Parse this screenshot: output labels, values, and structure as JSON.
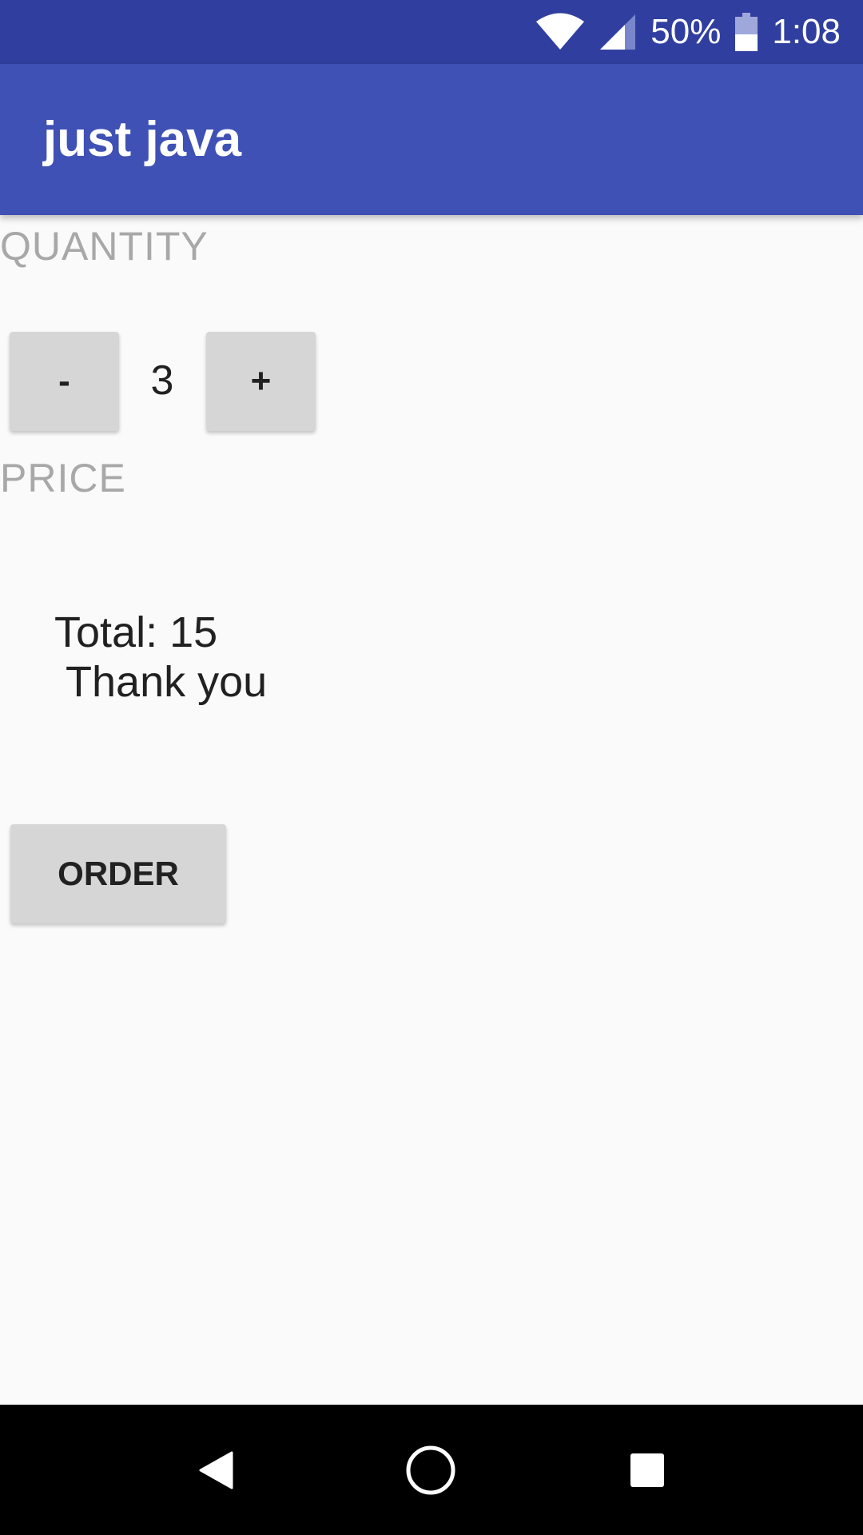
{
  "status_bar": {
    "wifi_icon": "wifi-icon",
    "cell_icon": "cell-signal-icon",
    "battery_text": "50%",
    "battery_level": 0.5,
    "time": "1:08",
    "background_color": "#303f9f"
  },
  "app_bar": {
    "title": "just java",
    "background_color": "#3f51b5"
  },
  "quantity": {
    "header": "QUANTITY",
    "decrement_label": "-",
    "value": "3",
    "increment_label": "+"
  },
  "price": {
    "header": "PRICE",
    "total_line": "Total: 15",
    "thank_you_line": " Thank you"
  },
  "order_button": {
    "label": "ORDER"
  },
  "nav_bar": {
    "back_icon": "back-triangle-icon",
    "home_icon": "home-circle-icon",
    "recents_icon": "recents-square-icon"
  }
}
